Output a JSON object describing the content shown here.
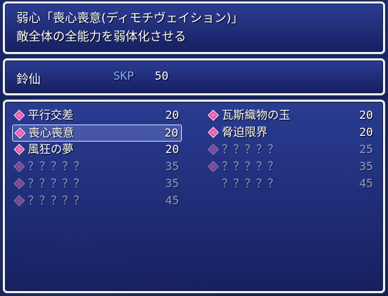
{
  "help": {
    "line1": "弱心「喪心喪意(ディモチヴェイション)」",
    "line2": "敵全体の全能力を弱体化させる"
  },
  "status": {
    "actor_name": "鈴仙",
    "skp_label": "SKP",
    "skp_value": "50"
  },
  "skills": {
    "left": [
      {
        "name": "平行交差",
        "cost": "20",
        "icon": "diamond-icon",
        "enabled": true,
        "selected": false
      },
      {
        "name": "喪心喪意",
        "cost": "20",
        "icon": "diamond-icon",
        "enabled": true,
        "selected": true
      },
      {
        "name": "風狂の夢",
        "cost": "20",
        "icon": "diamond-icon",
        "enabled": true,
        "selected": false
      },
      {
        "name": "？？？？？",
        "cost": "35",
        "icon": "diamond-icon",
        "enabled": false,
        "selected": false
      },
      {
        "name": "？？？？？",
        "cost": "35",
        "icon": "diamond-icon",
        "enabled": false,
        "selected": false
      },
      {
        "name": "？？？？？",
        "cost": "45",
        "icon": "diamond-icon",
        "enabled": false,
        "selected": false
      }
    ],
    "right": [
      {
        "name": "瓦斯織物の玉",
        "cost": "20",
        "icon": "diamond-icon",
        "enabled": true,
        "selected": false
      },
      {
        "name": "脅迫限界",
        "cost": "20",
        "icon": "diamond-icon",
        "enabled": true,
        "selected": false
      },
      {
        "name": "？？？？？",
        "cost": "25",
        "icon": "diamond-icon",
        "enabled": false,
        "selected": false
      },
      {
        "name": "？？？？？",
        "cost": "35",
        "icon": "diamond-icon",
        "enabled": false,
        "selected": false
      },
      {
        "name": "？？？？？",
        "cost": "45",
        "icon": "",
        "enabled": false,
        "selected": false
      }
    ]
  },
  "colors": {
    "window_top": "#2c3e96",
    "window_bottom": "#162060",
    "border": "#e8ecf4",
    "icon_pink": "#e040a0",
    "skp_label": "#8fb0ff"
  }
}
